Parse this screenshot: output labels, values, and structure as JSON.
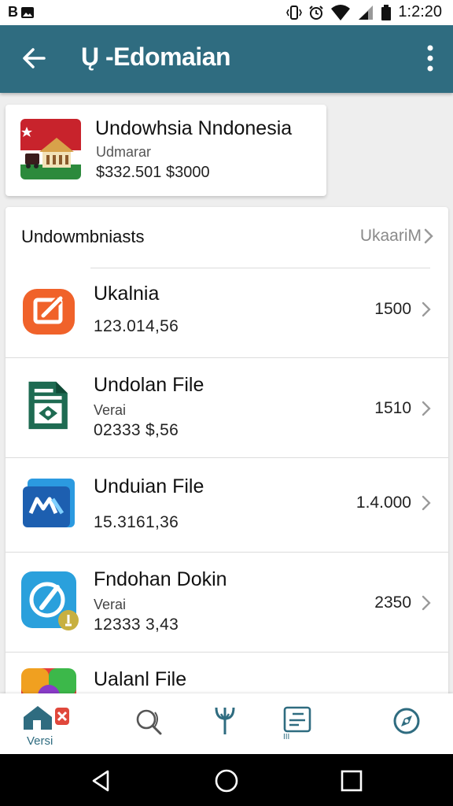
{
  "status_bar": {
    "left_label": "B",
    "time": "1:2:20"
  },
  "app_bar": {
    "title": "Ų -Edomaian",
    "back_icon": "arrow-back-icon",
    "menu_icon": "more-vertical-icon"
  },
  "country_card": {
    "name": "Undowhsia Nndonesia",
    "subtitle": "Udmarar",
    "price": "$332.501 $3000"
  },
  "section": {
    "title": "Undowmbniasts",
    "link": "UkaariM"
  },
  "items": [
    {
      "name": "Ukalnia",
      "sub": "",
      "number": "123.014,56",
      "value": "1500",
      "icon": "orange-edit-app-icon",
      "color": "#f0622a"
    },
    {
      "name": "Undolan File",
      "sub": "Verai",
      "number": "02333 $,56",
      "value": "1510",
      "icon": "green-document-icon",
      "color": "#1e6b52"
    },
    {
      "name": "Unduian File",
      "sub": "",
      "number": "15.3161,36",
      "value": "1.4.000",
      "icon": "blue-app-icon",
      "color": "#1d5fb0"
    },
    {
      "name": "Fndohan Dokin",
      "sub": "Verai",
      "number": "12333 3,43",
      "value": "2350",
      "icon": "blue-edit-app-icon",
      "color": "#2aa0dc"
    },
    {
      "name": "Ualanl File",
      "sub": "",
      "number": "",
      "value": "",
      "icon": "rainbow-app-icon",
      "color": "#e43c3c"
    }
  ],
  "bottom_nav": {
    "items": [
      {
        "icon": "home-icon",
        "label": "Versi"
      },
      {
        "icon": "search-icon",
        "label": ""
      },
      {
        "icon": "trident-icon",
        "label": ""
      },
      {
        "icon": "document-icon",
        "label": "III"
      },
      {
        "icon": "compass-icon",
        "label": ""
      }
    ]
  },
  "colors": {
    "app_bar": "#2f6c80",
    "accent": "#2f6c80"
  }
}
